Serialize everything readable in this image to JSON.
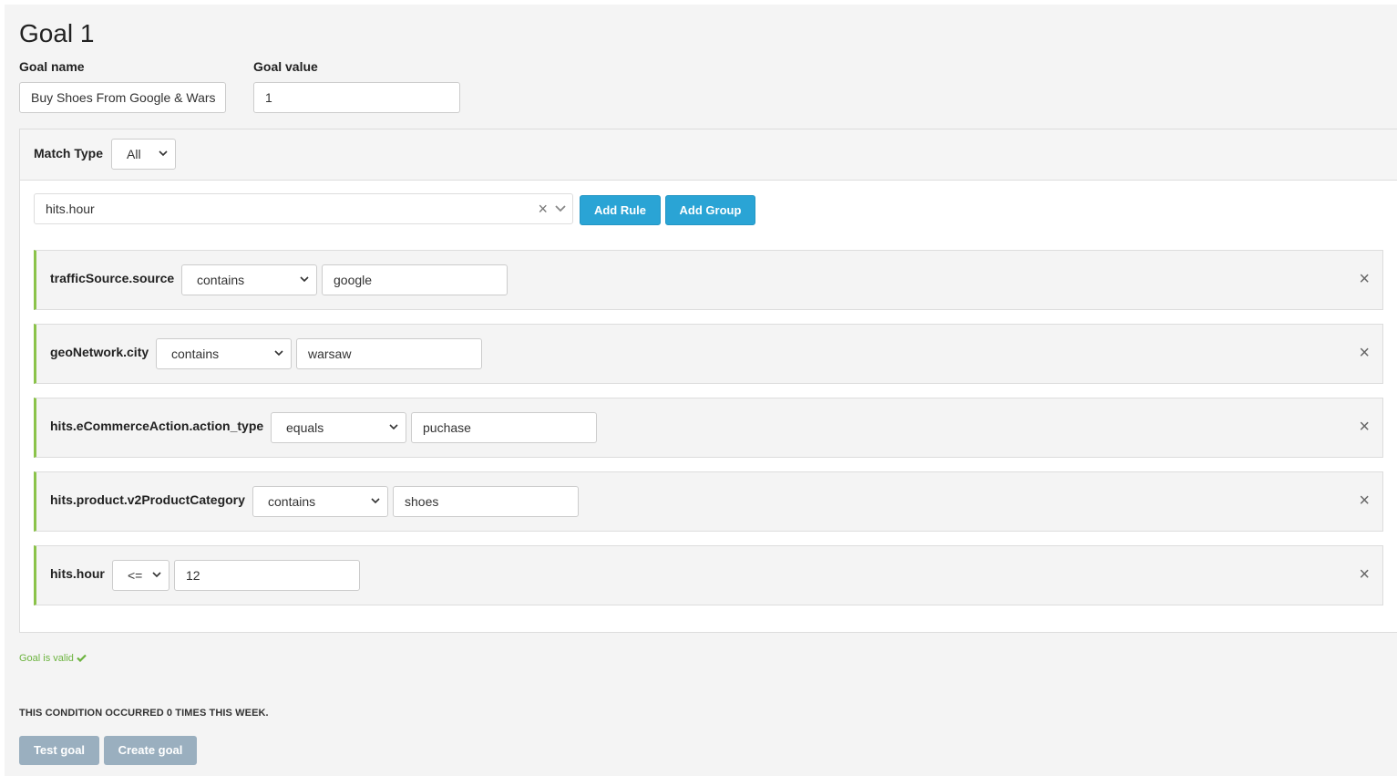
{
  "goal": {
    "title": "Goal 1",
    "name_label": "Goal name",
    "name_value": "Buy Shoes From Google & Wars",
    "value_label": "Goal value",
    "value_value": "1"
  },
  "builder": {
    "match_type_label": "Match Type",
    "match_type_value": "All",
    "field_picker_value": "hits.hour",
    "add_rule_label": "Add Rule",
    "add_group_label": "Add Group",
    "rules": [
      {
        "field": "trafficSource.source",
        "operator": "contains",
        "value": "google"
      },
      {
        "field": "geoNetwork.city",
        "operator": "contains",
        "value": "warsaw"
      },
      {
        "field": "hits.eCommerceAction.action_type",
        "operator": "equals",
        "value": "puchase"
      },
      {
        "field": "hits.product.v2ProductCategory",
        "operator": "contains",
        "value": "shoes"
      },
      {
        "field": "hits.hour",
        "operator": "<=",
        "value": "12"
      }
    ],
    "remove_symbol": "×",
    "clear_symbol": "×"
  },
  "status": {
    "valid_text": "Goal is valid",
    "valid_icon": "check-icon",
    "occurrence_text": "THIS CONDITION OCCURRED 0 TIMES THIS WEEK."
  },
  "actions": {
    "test_label": "Test goal",
    "create_label": "Create goal"
  },
  "colors": {
    "accent": "#2aa4d5",
    "valid": "#6cb33f",
    "rule_border": "#8bc34a",
    "disabled_button": "#9aafbf"
  }
}
